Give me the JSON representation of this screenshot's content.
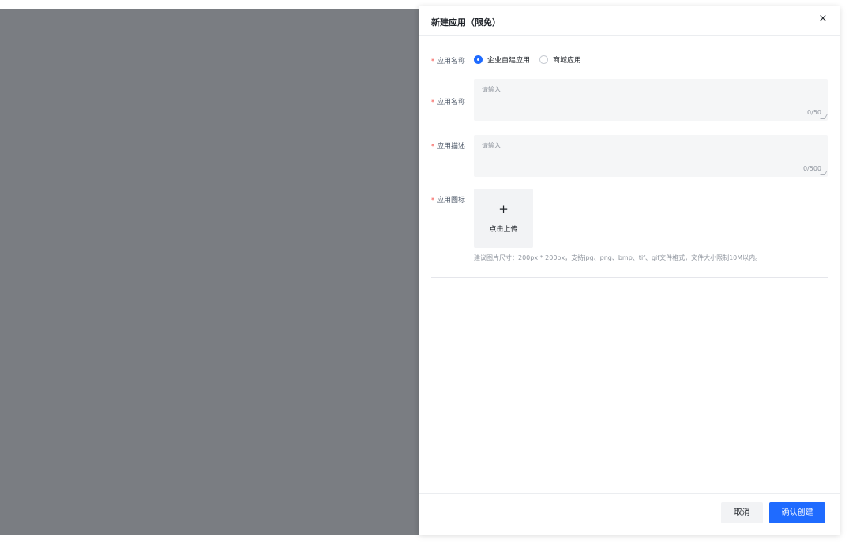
{
  "drawer": {
    "title": "新建应用（限免）",
    "close_icon": "×"
  },
  "form": {
    "required_mark": "*",
    "type": {
      "label": "应用名称",
      "options": [
        {
          "label": "企业自建应用",
          "selected": true
        },
        {
          "label": "商城应用",
          "selected": false
        }
      ]
    },
    "name": {
      "label": "应用名称",
      "placeholder": "请输入",
      "counter": "0/50"
    },
    "description": {
      "label": "应用描述",
      "placeholder": "请输入",
      "counter": "0/500"
    },
    "icon": {
      "label": "应用图标",
      "upload_plus": "+",
      "upload_text": "点击上传",
      "hint": "建议图片尺寸：200px * 200px，支持jpg、png、bmp、tif、gif文件格式，文件大小限制10M以内。"
    }
  },
  "footer": {
    "cancel_label": "取消",
    "confirm_label": "确认创建"
  },
  "colors": {
    "primary": "#1f6bff",
    "required": "#f54a45",
    "mask": "#7a7d82"
  }
}
